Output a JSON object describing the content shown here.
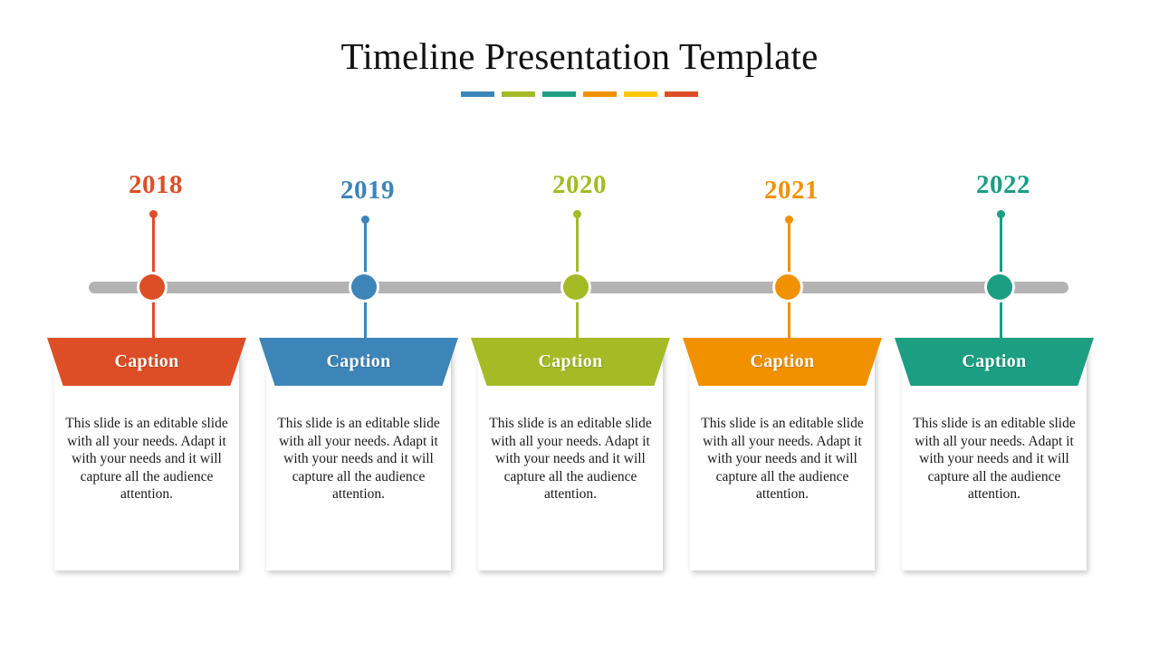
{
  "slide": {
    "title": "Timeline Presentation Template",
    "title_color": "#111111",
    "background": "#ffffff"
  },
  "title_divider": {
    "colors": [
      "#3D85B8",
      "#A4BB26",
      "#1C9E82",
      "#F29100",
      "#FBC707",
      "#DE4E26"
    ]
  },
  "timeline": {
    "bar_color": "#b3b3b3",
    "items": [
      {
        "year": "2018",
        "color": "#DE4E26",
        "caption": "Caption",
        "body": "This slide is an editable slide with all your needs. Adapt it with your needs and it will capture all the audience attention."
      },
      {
        "year": "2019",
        "color": "#3D85B8",
        "caption": "Caption",
        "body": "This slide is an editable slide with all your needs. Adapt it with your needs and it will capture all the audience attention."
      },
      {
        "year": "2020",
        "color": "#A4BB26",
        "caption": "Caption",
        "body": "This slide is an editable slide with all your needs. Adapt it with your needs and it will capture all the audience attention."
      },
      {
        "year": "2021",
        "color": "#F29100",
        "caption": "Caption",
        "body": "This slide is an editable slide with all your needs. Adapt it with your needs and it will capture all the audience attention."
      },
      {
        "year": "2022",
        "color": "#1C9E82",
        "caption": "Caption",
        "body": "This slide is an editable slide with all your needs. Adapt it with your needs and it will capture all the audience attention."
      }
    ]
  }
}
